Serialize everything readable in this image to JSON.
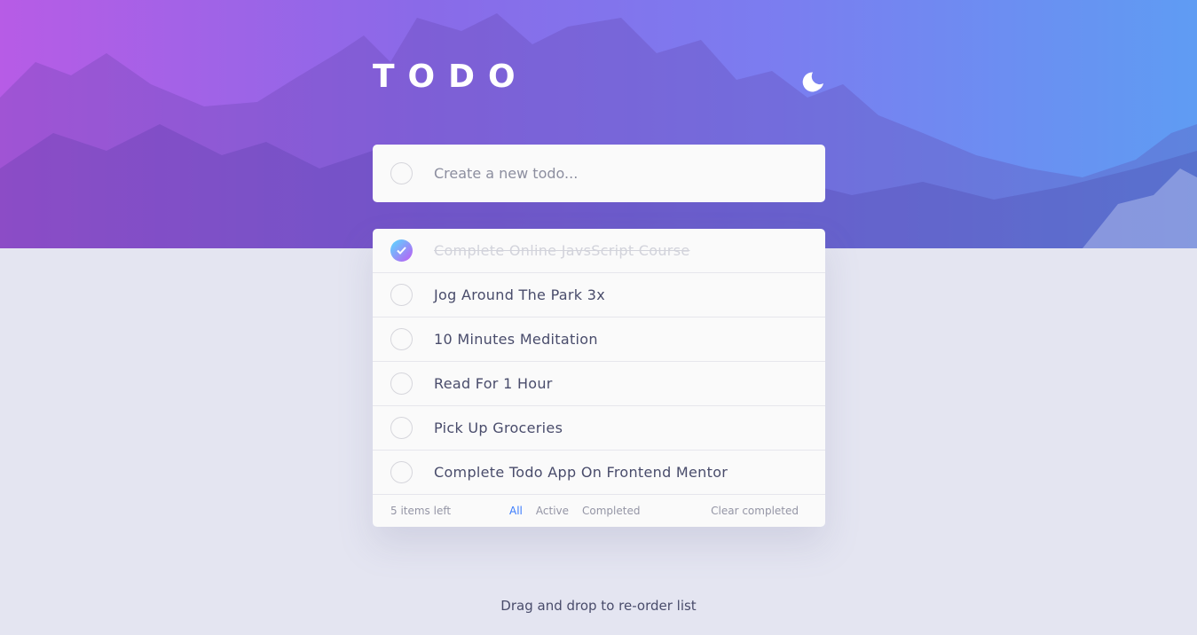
{
  "header": {
    "title": "TODO",
    "theme_toggle_icon": "moon-icon"
  },
  "new_todo": {
    "placeholder": "Create a new todo..."
  },
  "todos": [
    {
      "label": "Complete Online JavsScript Course",
      "completed": true
    },
    {
      "label": "Jog Around The Park 3x",
      "completed": false
    },
    {
      "label": "10 Minutes Meditation",
      "completed": false
    },
    {
      "label": "Read For 1 Hour",
      "completed": false
    },
    {
      "label": "Pick Up Groceries",
      "completed": false
    },
    {
      "label": "Complete Todo App On Frontend Mentor",
      "completed": false
    }
  ],
  "footer": {
    "items_left": "5 items left",
    "filter_all": "All",
    "filter_active": "Active",
    "filter_completed": "Completed",
    "clear_completed": "Clear completed"
  },
  "hint": "Drag and drop to re-order list",
  "colors": {
    "page_background": "#e4e5f1",
    "accent_blue": "#3a7bfd",
    "check_gradient_start": "#57ddff",
    "check_gradient_end": "#c058f3",
    "hero_gradient_start": "#b75ce6",
    "hero_gradient_end": "#5f9cf3"
  }
}
